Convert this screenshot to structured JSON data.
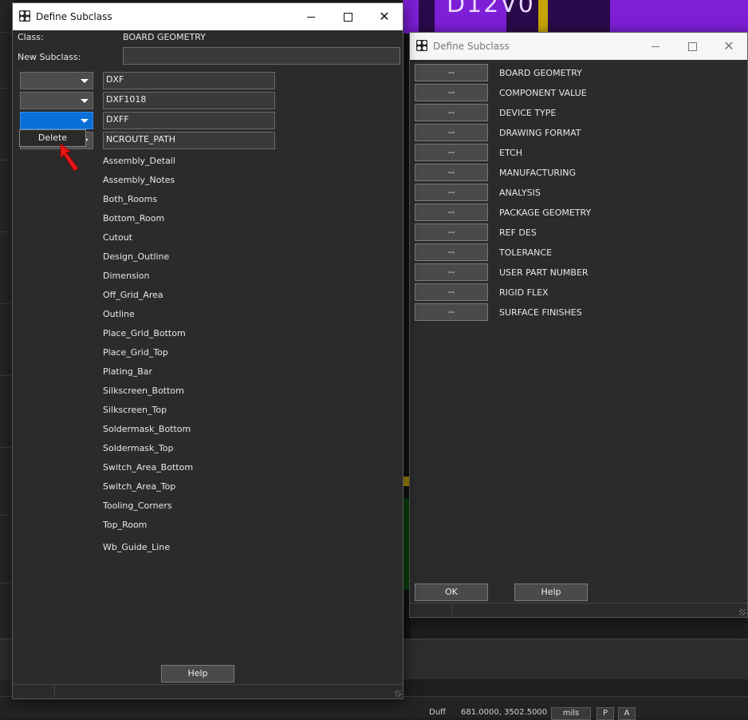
{
  "background": {
    "pcb_label": "D12V0",
    "status": {
      "layer": "Duff",
      "coords": "681.0000, 3502.5000",
      "units": "mils",
      "p_button": "P",
      "a_button": "A"
    }
  },
  "dialog_main": {
    "title": "Define Subclass",
    "class_label": "Class:",
    "class_value": "BOARD GEOMETRY",
    "new_subclass_label": "New Subclass:",
    "new_subclass_value": "",
    "rows": [
      {
        "value": "DXF"
      },
      {
        "value": "DXF1018"
      },
      {
        "value": "DXFF"
      },
      {
        "value": "NCROUTE_PATH"
      }
    ],
    "popup_menu": [
      "Delete"
    ],
    "subclasses": [
      "Assembly_Detail",
      "Assembly_Notes",
      "Both_Rooms",
      "Bottom_Room",
      "Cutout",
      "Design_Outline",
      "Dimension",
      "Off_Grid_Area",
      "Outline",
      "Place_Grid_Bottom",
      "Place_Grid_Top",
      "Plating_Bar",
      "Silkscreen_Bottom",
      "Silkscreen_Top",
      "Soldermask_Bottom",
      "Soldermask_Top",
      "Switch_Area_Bottom",
      "Switch_Area_Top",
      "Tooling_Corners",
      "Top_Room",
      "Wb_Guide_Line"
    ],
    "help_label": "Help"
  },
  "dialog_classes": {
    "title": "Define Subclass",
    "button_label": "--",
    "classes": [
      "BOARD GEOMETRY",
      "COMPONENT VALUE",
      "DEVICE TYPE",
      "DRAWING FORMAT",
      "ETCH",
      "MANUFACTURING",
      "ANALYSIS",
      "PACKAGE GEOMETRY",
      "REF DES",
      "TOLERANCE",
      "USER PART NUMBER",
      "RIGID FLEX",
      "SURFACE FINISHES"
    ],
    "ok_label": "OK",
    "help_label": "Help"
  },
  "colors": {
    "dialog_bg": "#2b2b2b",
    "selected_dropdown": "#0a6fd6",
    "pcb_purple": "#7d1fd6",
    "cursor": "#e81818"
  }
}
